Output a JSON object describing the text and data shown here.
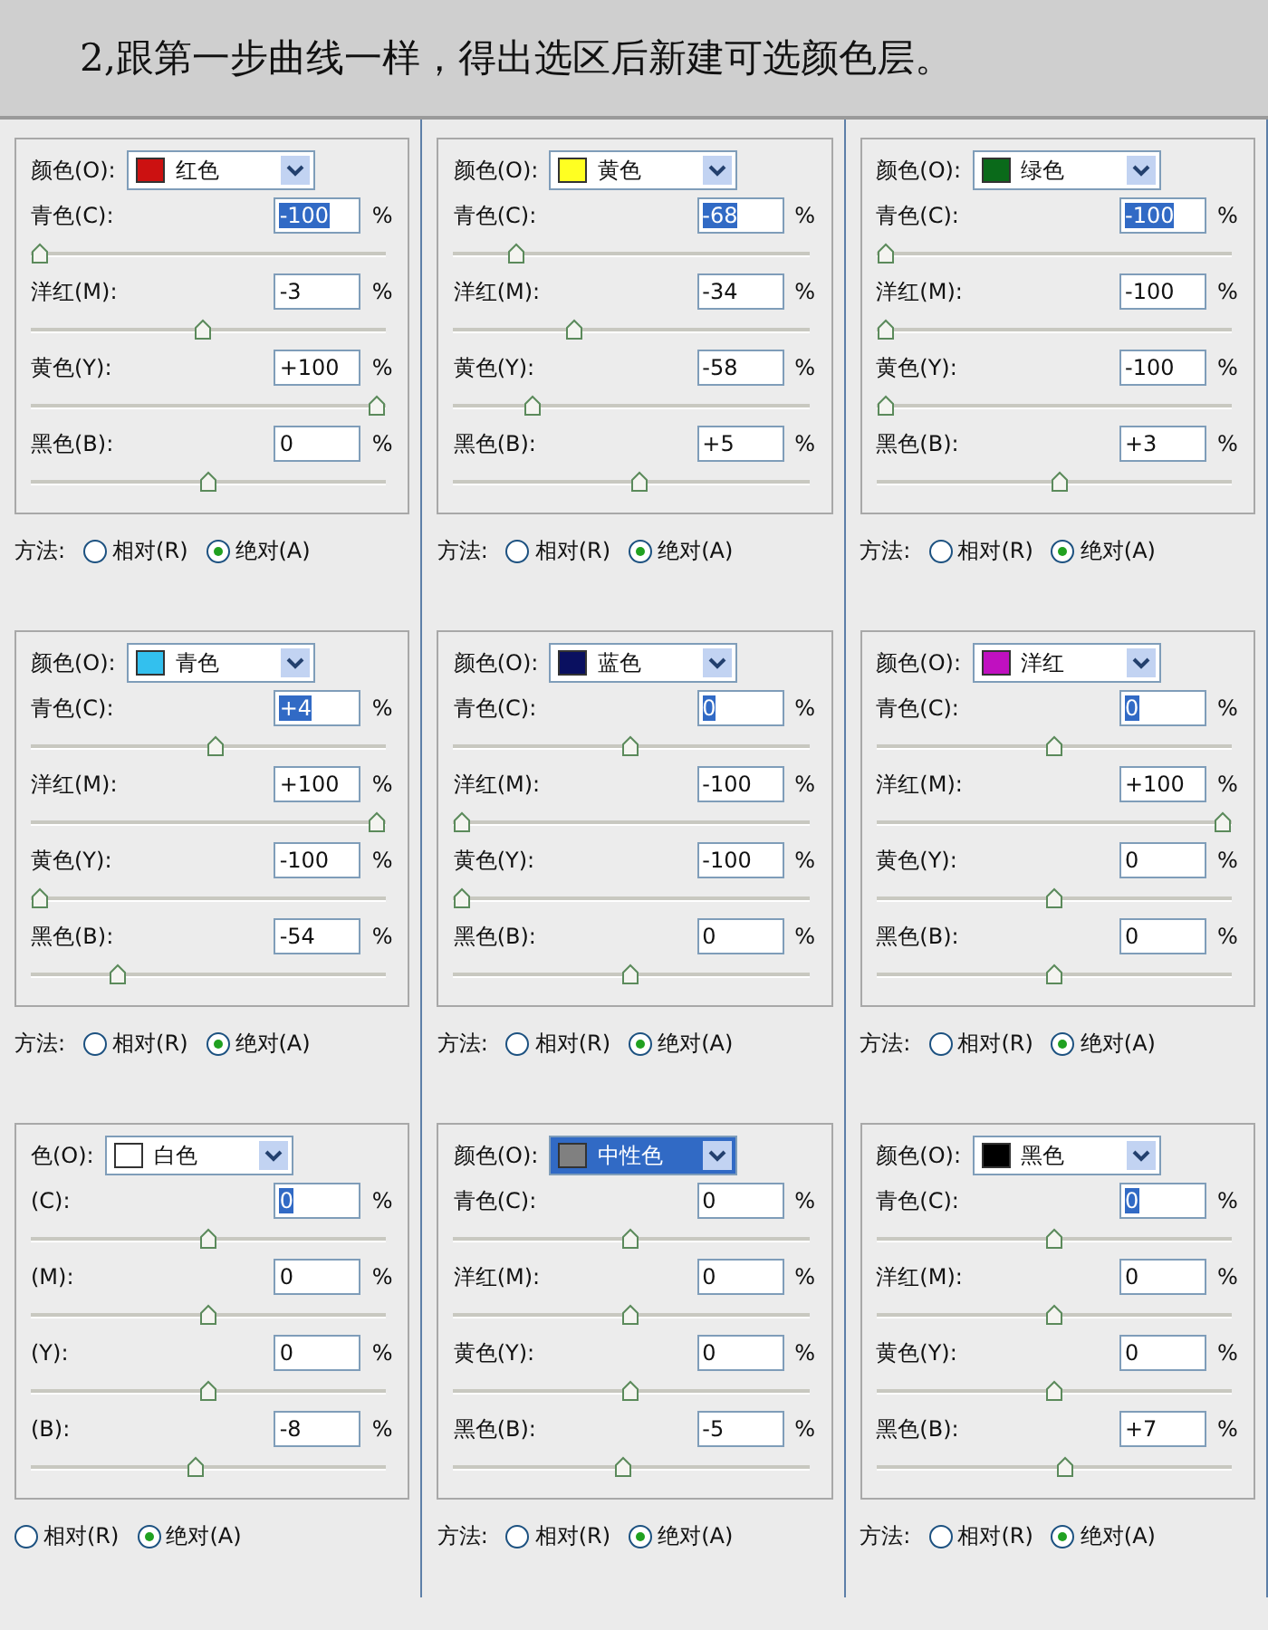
{
  "title": "2,跟第一步曲线一样，得出选区后新建可选颜色层。",
  "panels": [
    {
      "color_label": "颜色(O):",
      "color": "#cc1111",
      "color_name": "红色",
      "dropdown_selected": false,
      "method_label": "方法:",
      "rows": [
        {
          "label": "青色(C):",
          "value": "-100",
          "unit": "%",
          "selected": true,
          "level": 0
        },
        {
          "label": "洋红(M):",
          "value": "-3",
          "unit": "%",
          "selected": false,
          "level": 0.485
        },
        {
          "label": "黄色(Y):",
          "value": "+100",
          "unit": "%",
          "selected": false,
          "level": 1
        },
        {
          "label": "黑色(B):",
          "value": "0",
          "unit": "%",
          "selected": false,
          "level": 0.5
        }
      ],
      "options": [
        {
          "label": "相对(R)",
          "selected": false
        },
        {
          "label": "绝对(A)",
          "selected": true
        }
      ]
    },
    {
      "color_label": "颜色(O):",
      "color": "#ffff22",
      "color_name": "黄色",
      "dropdown_selected": false,
      "method_label": "方法:",
      "rows": [
        {
          "label": "青色(C):",
          "value": "-68",
          "unit": "%",
          "selected": true,
          "level": 0.16
        },
        {
          "label": "洋红(M):",
          "value": "-34",
          "unit": "%",
          "selected": false,
          "level": 0.33
        },
        {
          "label": "黄色(Y):",
          "value": "-58",
          "unit": "%",
          "selected": false,
          "level": 0.21
        },
        {
          "label": "黑色(B):",
          "value": "+5",
          "unit": "%",
          "selected": false,
          "level": 0.525
        }
      ],
      "options": [
        {
          "label": "相对(R)",
          "selected": false
        },
        {
          "label": "绝对(A)",
          "selected": true
        }
      ]
    },
    {
      "color_label": "颜色(O):",
      "color": "#0a6a1a",
      "color_name": "绿色",
      "dropdown_selected": false,
      "method_label": "方法:",
      "rows": [
        {
          "label": "青色(C):",
          "value": "-100",
          "unit": "%",
          "selected": true,
          "level": 0
        },
        {
          "label": "洋红(M):",
          "value": "-100",
          "unit": "%",
          "selected": false,
          "level": 0
        },
        {
          "label": "黄色(Y):",
          "value": "-100",
          "unit": "%",
          "selected": false,
          "level": 0
        },
        {
          "label": "黑色(B):",
          "value": "+3",
          "unit": "%",
          "selected": false,
          "level": 0.515
        }
      ],
      "options": [
        {
          "label": "相对(R)",
          "selected": false
        },
        {
          "label": "绝对(A)",
          "selected": true
        }
      ]
    },
    {
      "color_label": "颜色(O):",
      "color": "#33c0ee",
      "color_name": "青色",
      "dropdown_selected": false,
      "method_label": "方法:",
      "rows": [
        {
          "label": "青色(C):",
          "value": "+4",
          "unit": "%",
          "selected": true,
          "level": 0.52
        },
        {
          "label": "洋红(M):",
          "value": "+100",
          "unit": "%",
          "selected": false,
          "level": 1
        },
        {
          "label": "黄色(Y):",
          "value": "-100",
          "unit": "%",
          "selected": false,
          "level": 0
        },
        {
          "label": "黑色(B):",
          "value": "-54",
          "unit": "%",
          "selected": false,
          "level": 0.23
        }
      ],
      "options": [
        {
          "label": "相对(R)",
          "selected": false
        },
        {
          "label": "绝对(A)",
          "selected": true
        }
      ]
    },
    {
      "color_label": "颜色(O):",
      "color": "#0a1060",
      "color_name": "蓝色",
      "dropdown_selected": false,
      "method_label": "方法:",
      "rows": [
        {
          "label": "青色(C):",
          "value": "0",
          "unit": "%",
          "selected": true,
          "level": 0.5
        },
        {
          "label": "洋红(M):",
          "value": "-100",
          "unit": "%",
          "selected": false,
          "level": 0
        },
        {
          "label": "黄色(Y):",
          "value": "-100",
          "unit": "%",
          "selected": false,
          "level": 0
        },
        {
          "label": "黑色(B):",
          "value": "0",
          "unit": "%",
          "selected": false,
          "level": 0.5
        }
      ],
      "options": [
        {
          "label": "相对(R)",
          "selected": false
        },
        {
          "label": "绝对(A)",
          "selected": true
        }
      ]
    },
    {
      "color_label": "颜色(O):",
      "color": "#c010c0",
      "color_name": "洋红",
      "dropdown_selected": false,
      "method_label": "方法:",
      "rows": [
        {
          "label": "青色(C):",
          "value": "0",
          "unit": "%",
          "selected": true,
          "level": 0.5
        },
        {
          "label": "洋红(M):",
          "value": "+100",
          "unit": "%",
          "selected": false,
          "level": 1
        },
        {
          "label": "黄色(Y):",
          "value": "0",
          "unit": "%",
          "selected": false,
          "level": 0.5
        },
        {
          "label": "黑色(B):",
          "value": "0",
          "unit": "%",
          "selected": false,
          "level": 0.5
        }
      ],
      "options": [
        {
          "label": "相对(R)",
          "selected": false
        },
        {
          "label": "绝对(A)",
          "selected": true
        }
      ]
    },
    {
      "color_label": "色(O):",
      "color": "#ffffff",
      "color_name": "白色",
      "dropdown_selected": false,
      "rows": [
        {
          "label": "(C):",
          "value": "0",
          "unit": "%",
          "selected": true,
          "level": 0.5
        },
        {
          "label": "(M):",
          "value": "0",
          "unit": "%",
          "selected": false,
          "level": 0.5
        },
        {
          "label": "(Y):",
          "value": "0",
          "unit": "%",
          "selected": false,
          "level": 0.5
        },
        {
          "label": "(B):",
          "value": "-8",
          "unit": "%",
          "selected": false,
          "level": 0.46
        }
      ],
      "options": [
        {
          "label": "相对(R)",
          "selected": false
        },
        {
          "label": "绝对(A)",
          "selected": true
        }
      ]
    },
    {
      "color_label": "颜色(O):",
      "color": "#808080",
      "color_name": "中性色",
      "dropdown_selected": true,
      "method_label": "方法:",
      "rows": [
        {
          "label": "青色(C):",
          "value": "0",
          "unit": "%",
          "selected": false,
          "level": 0.5
        },
        {
          "label": "洋红(M):",
          "value": "0",
          "unit": "%",
          "selected": false,
          "level": 0.5
        },
        {
          "label": "黄色(Y):",
          "value": "0",
          "unit": "%",
          "selected": false,
          "level": 0.5
        },
        {
          "label": "黑色(B):",
          "value": "-5",
          "unit": "%",
          "selected": false,
          "level": 0.475
        }
      ],
      "options": [
        {
          "label": "相对(R)",
          "selected": false
        },
        {
          "label": "绝对(A)",
          "selected": true
        }
      ]
    },
    {
      "color_label": "颜色(O):",
      "color": "#000000",
      "color_name": "黑色",
      "dropdown_selected": false,
      "method_label": "方法:",
      "rows": [
        {
          "label": "青色(C):",
          "value": "0",
          "unit": "%",
          "selected": true,
          "level": 0.5
        },
        {
          "label": "洋红(M):",
          "value": "0",
          "unit": "%",
          "selected": false,
          "level": 0.5
        },
        {
          "label": "黄色(Y):",
          "value": "0",
          "unit": "%",
          "selected": false,
          "level": 0.5
        },
        {
          "label": "黑色(B):",
          "value": "+7",
          "unit": "%",
          "selected": false,
          "level": 0.535
        }
      ],
      "options": [
        {
          "label": "相对(R)",
          "selected": false
        },
        {
          "label": "绝对(A)",
          "selected": true
        }
      ]
    }
  ]
}
